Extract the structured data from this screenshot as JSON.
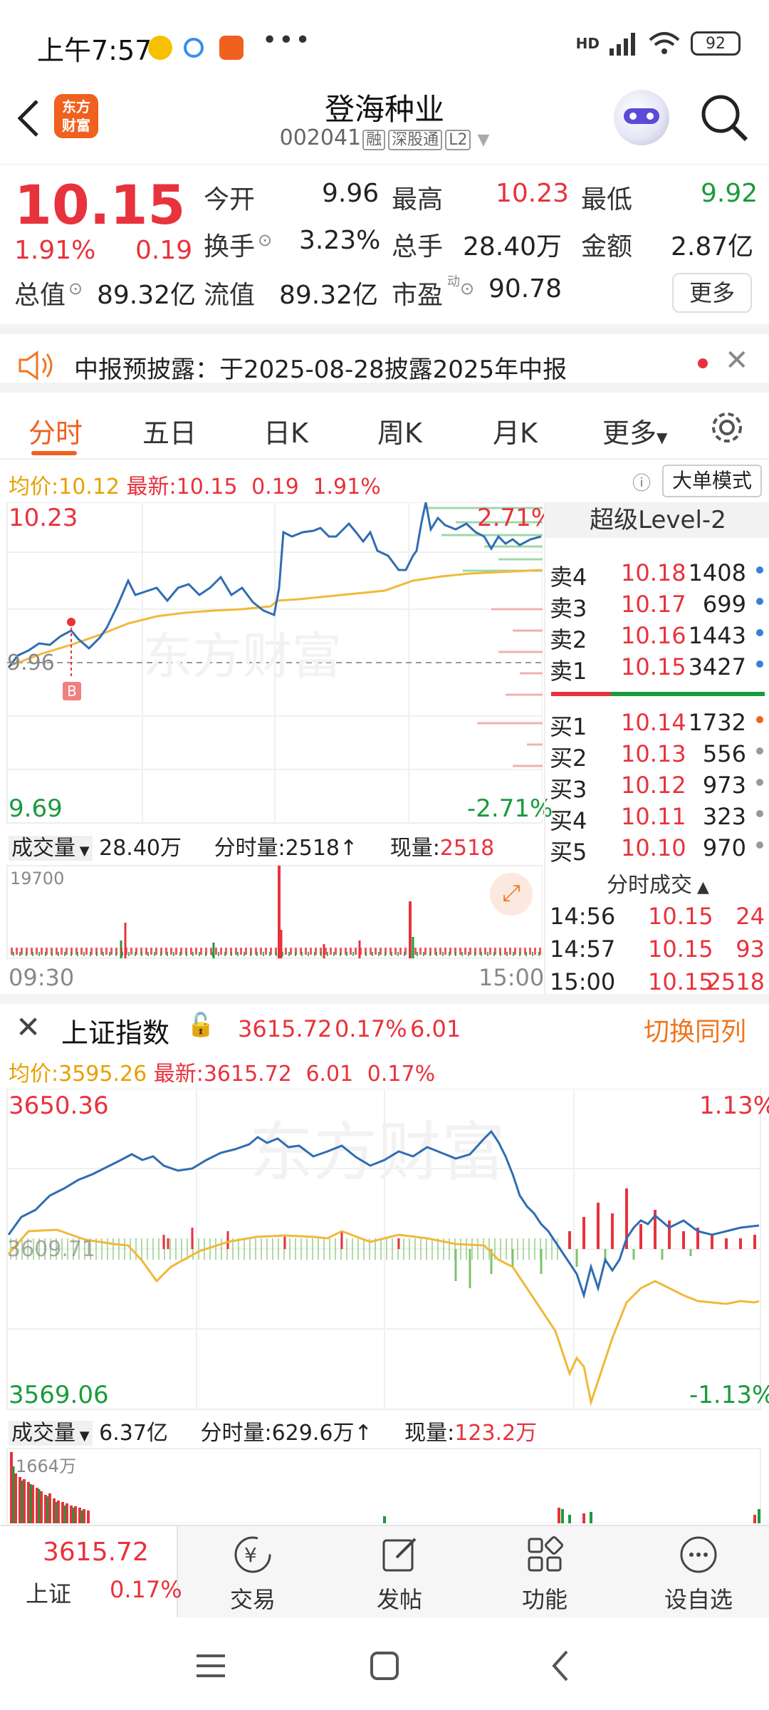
{
  "status_bar": {
    "time": "上午7:57",
    "battery": "92",
    "net": "HD"
  },
  "header": {
    "logo_text": [
      "东方",
      "财富"
    ],
    "stock_name": "登海种业",
    "code": "002041",
    "tags": [
      "融",
      "深股通",
      "L2"
    ]
  },
  "quote": {
    "price": "10.15",
    "change_pct": "1.91%",
    "change": "0.19",
    "rows": [
      [
        {
          "label": "今开",
          "value": "9.96",
          "color": "#222"
        },
        {
          "label": "最高",
          "value": "10.23",
          "color": "#e8323c"
        },
        {
          "label": "最低",
          "value": "9.92",
          "color": "#1a9b3c"
        }
      ],
      [
        {
          "label": "换手",
          "value": "3.23%",
          "color": "#222"
        },
        {
          "label": "总手",
          "value": "28.40万",
          "color": "#222"
        },
        {
          "label": "金额",
          "value": "2.87亿",
          "color": "#222"
        }
      ]
    ],
    "total_cap_label": "总值",
    "total_cap": "89.32亿",
    "float_cap_label": "流值",
    "float_cap": "89.32亿",
    "pe_label": "市盈",
    "pe_sup": "动",
    "pe": "90.78",
    "more": "更多"
  },
  "notice": {
    "text": "中报预披露：于2025-08-28披露2025年中报"
  },
  "tabs": [
    "分时",
    "五日",
    "日K",
    "周K",
    "月K",
    "更多"
  ],
  "intraday": {
    "avg_label": "均价:",
    "avg": "10.12",
    "latest_label": "最新:",
    "latest": "10.15",
    "chg": "0.19",
    "pct": "1.91%",
    "big_order_btn": "大单模式",
    "high": "10.23",
    "low": "9.69",
    "open": "9.96",
    "pos_pct": "2.71%",
    "neg_pct": "-2.71%",
    "buy_marker": "B",
    "watermark": "东方财富",
    "vol_label": "成交量",
    "vol": "28.40万",
    "tick_vol_label": "分时量:",
    "tick_vol": "2518↑",
    "cur_vol_label": "现量:",
    "cur_vol": "2518",
    "vol_max": "19700",
    "time_start": "09:30",
    "time_end": "15:00"
  },
  "order_book": {
    "title": "超级Level-2",
    "asks": [
      {
        "label": "卖4",
        "price": "10.18",
        "qty": "1408"
      },
      {
        "label": "卖3",
        "price": "10.17",
        "qty": "699"
      },
      {
        "label": "卖2",
        "price": "10.16",
        "qty": "1443"
      },
      {
        "label": "卖1",
        "price": "10.15",
        "qty": "3427"
      }
    ],
    "bids": [
      {
        "label": "买1",
        "price": "10.14",
        "qty": "1732"
      },
      {
        "label": "买2",
        "price": "10.13",
        "qty": "556"
      },
      {
        "label": "买3",
        "price": "10.12",
        "qty": "973"
      },
      {
        "label": "买4",
        "price": "10.11",
        "qty": "323"
      },
      {
        "label": "买5",
        "price": "10.10",
        "qty": "970"
      }
    ],
    "trades_title": "分时成交",
    "trades": [
      {
        "time": "14:56",
        "price": "10.15",
        "qty": "24"
      },
      {
        "time": "14:57",
        "price": "10.15",
        "qty": "93"
      },
      {
        "time": "15:00",
        "price": "10.15",
        "qty": "2518"
      }
    ]
  },
  "index_bar": {
    "name": "上证指数",
    "value": "3615.72",
    "pct": "0.17%",
    "chg": "6.01",
    "switch": "切换同列"
  },
  "index_chart": {
    "avg_label": "均价:",
    "avg": "3595.26",
    "latest_label": "最新:",
    "latest": "3615.72",
    "chg": "6.01",
    "pct": "0.17%",
    "high": "3650.36",
    "low": "3569.06",
    "mid": "3609.71",
    "pos_pct": "1.13%",
    "neg_pct": "-1.13%",
    "watermark": "东方财富",
    "vol_label": "成交量",
    "vol": "6.37亿",
    "tick_vol_label": "分时量:",
    "tick_vol": "629.6万↑",
    "cur_vol_label": "现量:",
    "cur_vol": "123.2万",
    "vol_max": "1664万"
  },
  "bottom_nav": {
    "index_value": "3615.72",
    "index_name": "上证",
    "index_pct": "0.17%",
    "items": [
      "交易",
      "发帖",
      "功能",
      "设自选"
    ]
  }
}
